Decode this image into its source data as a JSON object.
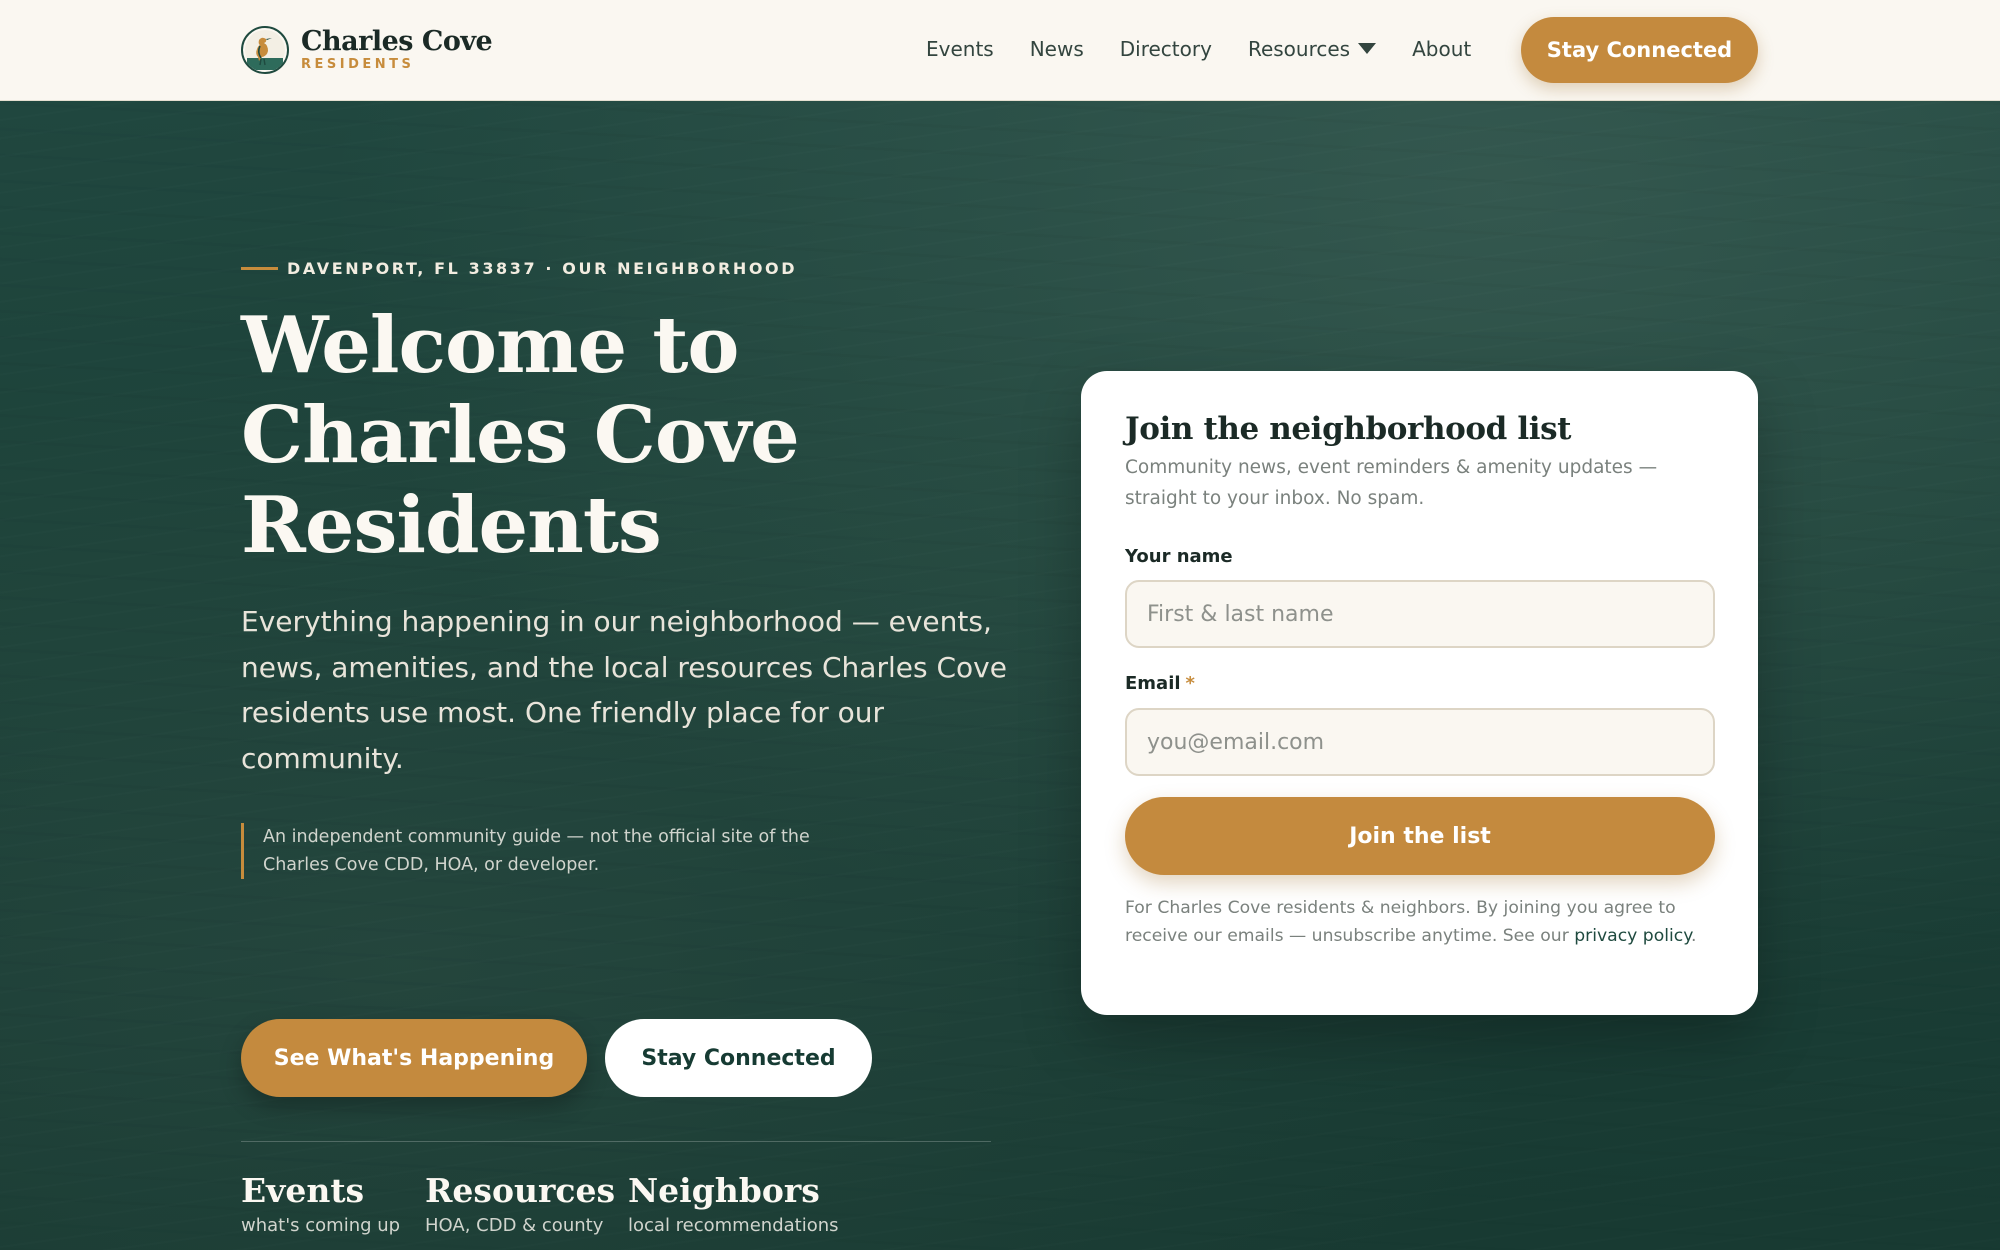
{
  "brand": {
    "name": "Charles Cove",
    "sub": "RESIDENTS"
  },
  "nav": {
    "links": [
      "Events",
      "News",
      "Directory",
      "Resources",
      "About"
    ],
    "cta": "Stay Connected"
  },
  "hero": {
    "eyebrow": "DAVENPORT, FL 33837 · OUR NEIGHBORHOOD",
    "title_lines": [
      "Welcome to",
      "Charles Cove",
      "Residents"
    ],
    "description": "Everything happening in our neighborhood — events, news, amenities, and the local resources Charles Cove residents use most. One friendly place for our community.",
    "disclaimer": "An independent community guide — not the official site of the Charles Cove CDD, HOA, or developer.",
    "primary_cta": "See What's Happening",
    "secondary_cta": "Stay Connected",
    "stats": [
      {
        "title": "Events",
        "sub": "what's coming up"
      },
      {
        "title": "Resources",
        "sub": "HOA, CDD & county"
      },
      {
        "title": "Neighbors",
        "sub": "local recommendations"
      }
    ]
  },
  "signup": {
    "title": "Join the neighborhood list",
    "description": "Community news, event reminders & amenity updates — straight to your inbox. No spam.",
    "name_label": "Your name",
    "name_placeholder": "First & last name",
    "name_value": "",
    "email_label": "Email",
    "email_required_mark": "*",
    "email_placeholder": "you@email.com",
    "email_value": "",
    "submit": "Join the list",
    "footer_text": "For Charles Cove residents & neighbors. By joining you agree to receive our emails — unsubscribe anytime. See our",
    "privacy_link": "privacy policy",
    "footer_end": "."
  },
  "colors": {
    "accent": "#c48a3e",
    "hero_bg": "#1d4239",
    "nav_bg": "#faf7f1",
    "card_bg": "#ffffff"
  },
  "icons": {
    "logo": "heron-bird-logo-icon",
    "dropdown": "caret-down-icon"
  }
}
